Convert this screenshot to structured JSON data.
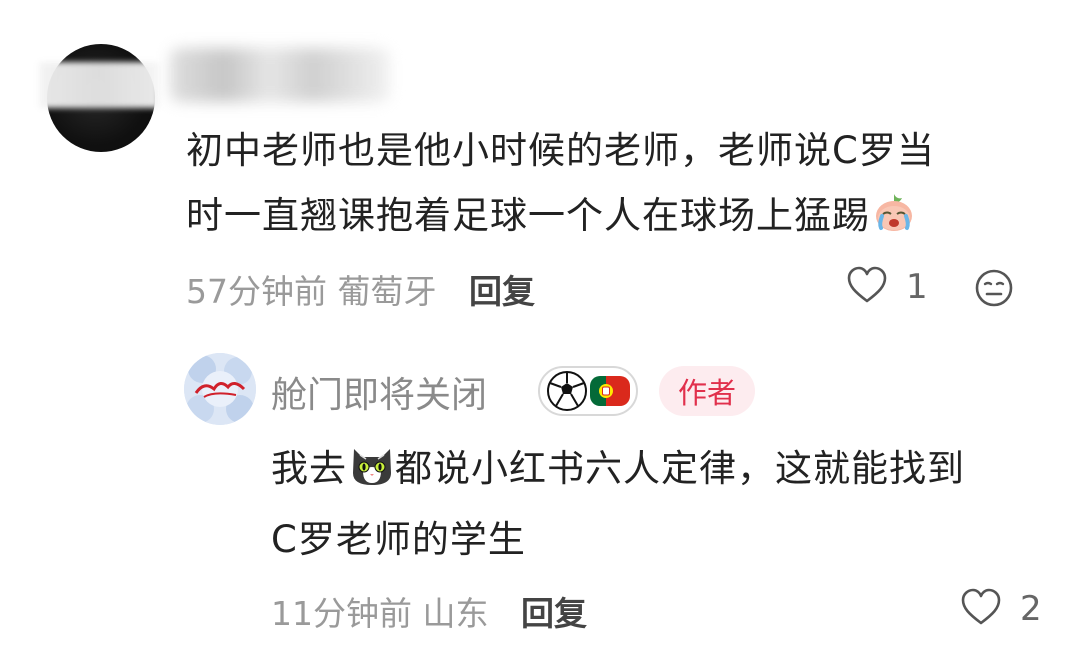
{
  "comment": {
    "author_name": "",
    "text_line1": "初中老师也是他小时候的老师，老师说C罗当",
    "text_line2": "时一直翘课抱着足球一个人在球场上猛踢",
    "time": "57分钟前",
    "location": "葡萄牙",
    "reply_label": "回复",
    "like_count": "1",
    "emoji": "crying-peach-emoji"
  },
  "reply": {
    "author_name": "舱门即将关闭",
    "badge_icon": "football-portugal-flag-badge",
    "author_tag": "作者",
    "text_before_emoji": "我去",
    "emoji": "cat-emoji",
    "text_after_emoji": "都说小红书六人定律，这就能找到",
    "text_line2": "C罗老师的学生",
    "time": "11分钟前",
    "location": "山东",
    "reply_label": "回复",
    "like_count": "2"
  },
  "colors": {
    "text": "#222222",
    "meta": "#9a9a9a",
    "author_tag_text": "#e1304c",
    "author_tag_bg": "#fdecef"
  }
}
